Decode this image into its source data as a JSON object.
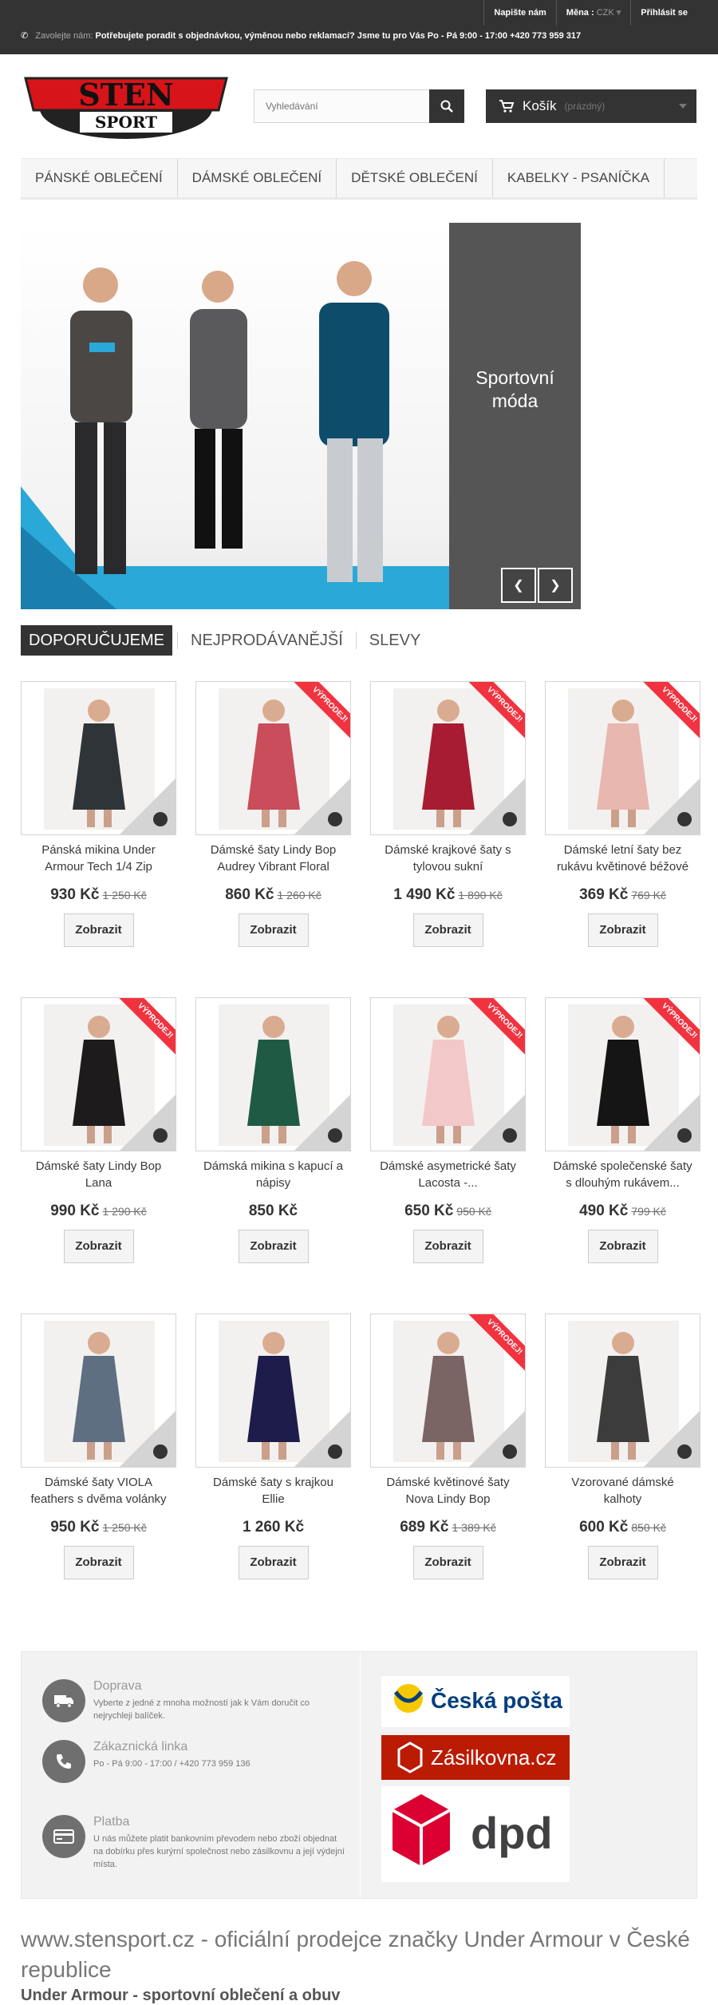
{
  "topbar": {
    "contact_us": "Napište nám",
    "currency_label": "Měna :",
    "currency_value": "CZK",
    "login": "Přihlásit se",
    "call_label": "Zavolejte nám:",
    "call_text": "Potřebujete poradit s objednávkou, výměnou nebo reklamací? Jsme tu pro Vás Po - Pá 9:00 - 17:00 +420 773 959 317"
  },
  "header": {
    "logo_top": "STEN",
    "logo_bottom": "SPORT",
    "search_placeholder": "Vyhledávání",
    "cart_label": "Košík",
    "cart_status": "(prázdný)"
  },
  "menu": [
    "Pánské oblečení",
    "Dámské oblečení",
    "Dětské oblečení",
    "Kabelky - psaníčka"
  ],
  "slider": {
    "caption": "Sportovní\nmóda"
  },
  "tabs": [
    "Doporučujeme",
    "Nejprodávanější",
    "Slevy"
  ],
  "products": [
    {
      "name": "Pánská mikina Under Armour Tech 1/4 Zip",
      "price": "930 Kč",
      "old": "1 250 Kč",
      "sale": false,
      "color": "#2f3438"
    },
    {
      "name": "Dámské šaty Lindy Bop Audrey Vibrant Floral",
      "price": "860 Kč",
      "old": "1 260 Kč",
      "sale": true,
      "color": "#c94d5a"
    },
    {
      "name": "Dámské krajkové šaty s tylovou sukní",
      "price": "1 490 Kč",
      "old": "1 890 Kč",
      "sale": true,
      "color": "#a81c33"
    },
    {
      "name": "Dámské letní šaty bez rukávu květinové béžové",
      "price": "369 Kč",
      "old": "769 Kč",
      "sale": true,
      "color": "#e7b7b0"
    },
    {
      "name": "Dámské šaty Lindy Bop Lana",
      "price": "990 Kč",
      "old": "1 290 Kč",
      "sale": true,
      "color": "#1d1b1b"
    },
    {
      "name": "Dámská mikina s kapucí a nápisy",
      "price": "850 Kč",
      "old": "",
      "sale": false,
      "color": "#1f5a44"
    },
    {
      "name": "Dámské asymetrické šaty Lacosta -...",
      "price": "650 Kč",
      "old": "950 Kč",
      "sale": true,
      "color": "#f3c8c8"
    },
    {
      "name": "Dámské společenské šaty s dlouhým rukávem...",
      "price": "490 Kč",
      "old": "799 Kč",
      "sale": true,
      "color": "#151515"
    },
    {
      "name": "Dámské šaty VIOLA feathers s dvěma volánky",
      "price": "950 Kč",
      "old": "1 250 Kč",
      "sale": false,
      "color": "#5f6f82"
    },
    {
      "name": "Dámské šaty s krajkou Ellie",
      "price": "1 260 Kč",
      "old": "",
      "sale": false,
      "color": "#1e1c4a"
    },
    {
      "name": "Dámské květinové šaty Nova Lindy Bop",
      "price": "689 Kč",
      "old": "1 389 Kč",
      "sale": true,
      "color": "#7a6464"
    },
    {
      "name": "Vzorované dámské kalhoty",
      "price": "600 Kč",
      "old": "850 Kč",
      "sale": false,
      "color": "#3c3c3c"
    }
  ],
  "labels": {
    "sale_ribbon": "Výprodej!",
    "view_button": "Zobrazit"
  },
  "info": [
    {
      "title": "Doprava",
      "text": "Vyberte z jedné z mnoha možností jak k Vám doručit co nejrychleji balíček.",
      "icon": "truck-icon"
    },
    {
      "title": "Zákaznická linka",
      "text": "Po - Pá 9:00 - 17:00 / +420 773 959 136",
      "icon": "phone-icon"
    },
    {
      "title": "Platba",
      "text": "U nás můžete platit bankovním převodem nebo zboží objednat na dobírku přes kurýrní společnost nebo zásilkovnu a její výdejní místa.",
      "icon": "credit-card-icon"
    }
  ],
  "carriers": [
    "Česká pošta",
    "Zásilkovna.cz",
    "dpd"
  ],
  "footer": {
    "title": "www.stensport.cz - oficiální prodejce značky Under Armour v České republice",
    "subtitle": "Under Armour - sportovní oblečení a obuv"
  },
  "colors": {
    "dark": "#333333",
    "sale": "#f13340",
    "posta": "#003e7e",
    "zasilkovna": "#ba1b02",
    "dpd": "#dc0032"
  }
}
